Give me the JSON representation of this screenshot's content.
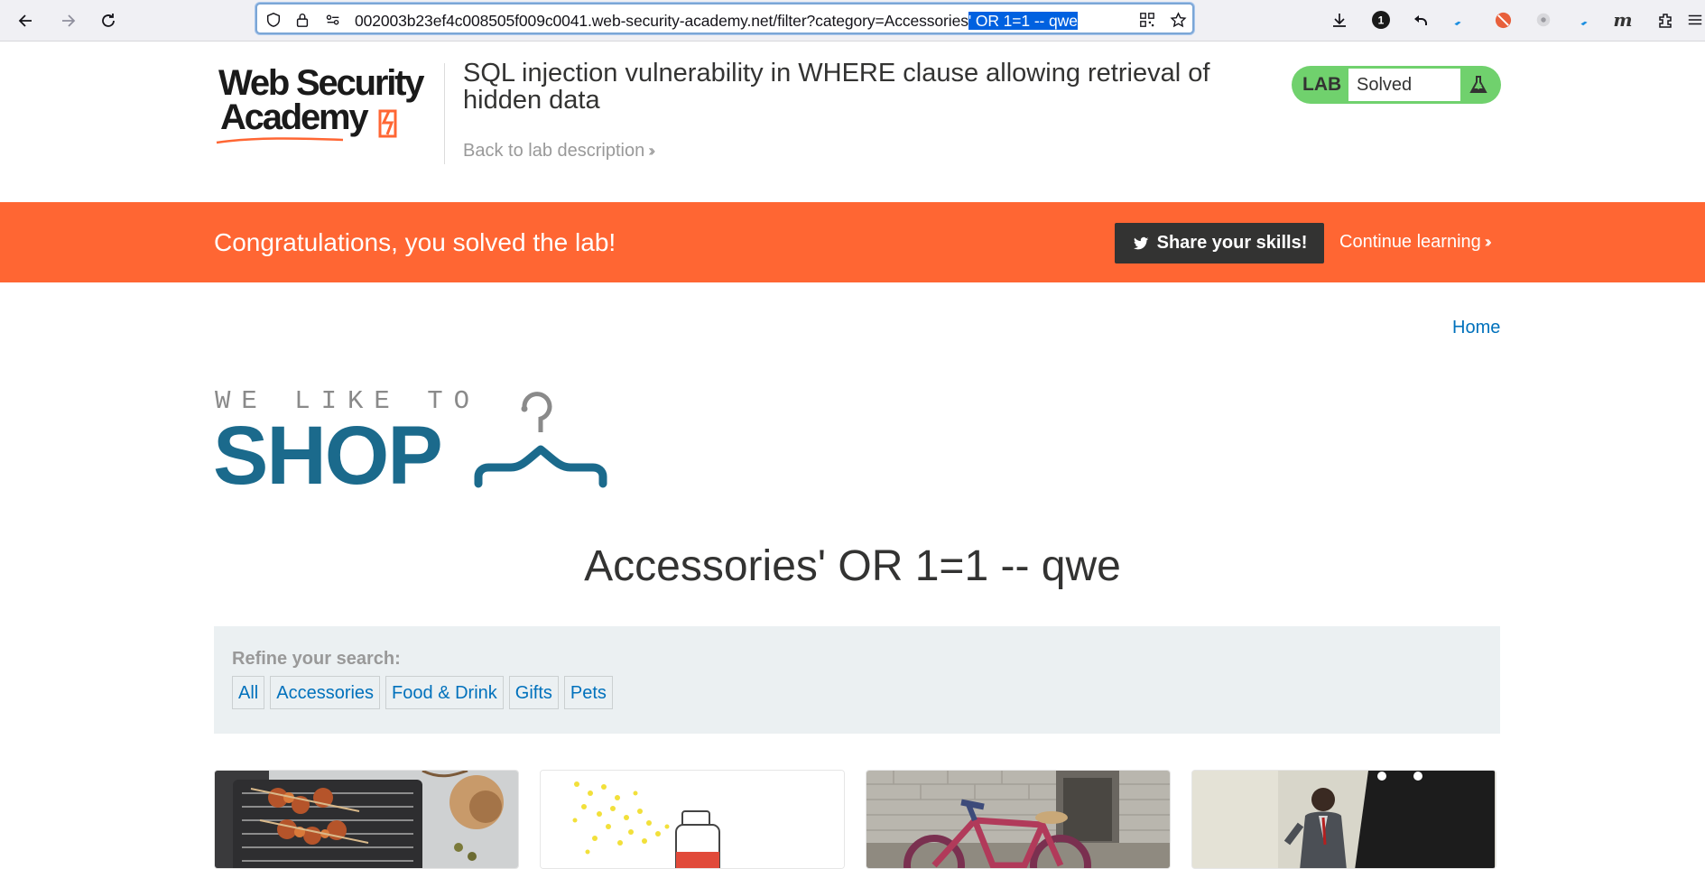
{
  "browser": {
    "url_main": "002003b23ef4c008505f009c0041.web-security-academy.net/filter?category=Accessories",
    "url_selected": "' OR 1=1 -- qwe",
    "toolbar_badge": "1"
  },
  "lab": {
    "logo_line1": "Web Security",
    "logo_line2": "Academy",
    "title": "SQL injection vulnerability in WHERE clause allowing retrieval of hidden data",
    "back_link": "Back to lab description",
    "status_label": "LAB",
    "status_value": "Solved"
  },
  "banner": {
    "message": "Congratulations, you solved the lab!",
    "share_label": "Share your skills!",
    "continue_label": "Continue learning"
  },
  "nav": {
    "home": "Home"
  },
  "shop_logo": {
    "tagline": "WE LIKE TO",
    "word": "SHOP"
  },
  "page": {
    "heading": "Accessories' OR 1=1 -- qwe"
  },
  "refine": {
    "label": "Refine your search:",
    "filters": [
      "All",
      "Accessories",
      "Food & Drink",
      "Gifts",
      "Pets"
    ]
  },
  "colors": {
    "brand_orange": "#ff6633",
    "link_blue": "#0071bc",
    "lab_green": "#70d16d",
    "shop_blue": "#1b6a8c"
  },
  "icons": [
    "back-arrow-icon",
    "forward-arrow-icon",
    "reload-icon",
    "shield-icon",
    "lock-icon",
    "permissions-icon",
    "qr-code-icon",
    "bookmark-star-icon",
    "download-icon",
    "undo-icon",
    "extension-icon",
    "menu-icon",
    "flask-icon",
    "twitter-icon",
    "hanger-icon"
  ]
}
